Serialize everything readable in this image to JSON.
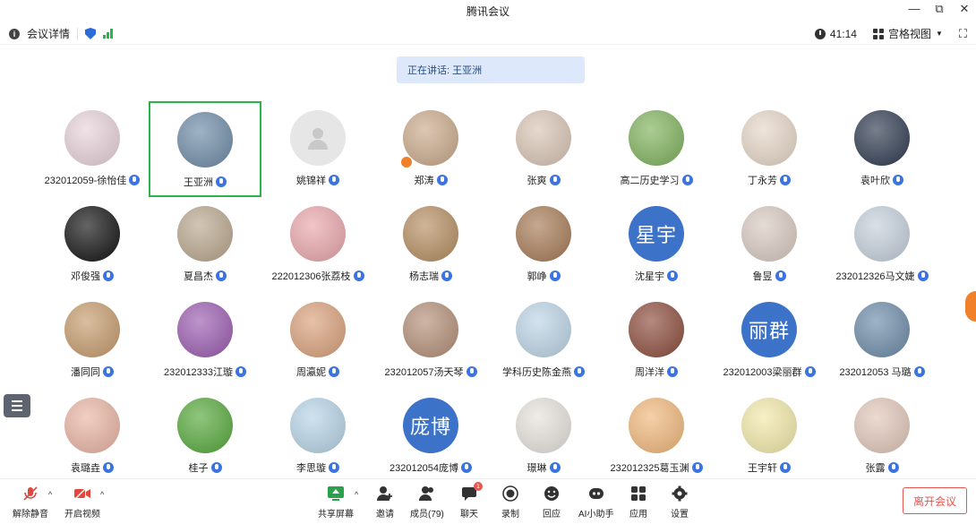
{
  "window": {
    "title": "腾讯会议",
    "minimize": "—",
    "restore": "⧉",
    "close": "✕"
  },
  "topbar": {
    "meeting_info": "会议详情",
    "timer": "41:14",
    "view_mode": "宫格视图",
    "colors": {
      "shield": "#2a6bd8",
      "signal": "#2cb34a"
    }
  },
  "speaking_banner": "正在讲话: 王亚洲",
  "participants": [
    {
      "name": "232012059-徐怡佳",
      "avatar_bg": "#e7d2d9"
    },
    {
      "name": "王亚洲",
      "avatar_bg": "#6d8aa6",
      "active": true
    },
    {
      "name": "姚锦祥",
      "avatar_bg": "#e6e6e6",
      "default": true
    },
    {
      "name": "郑涛",
      "avatar_bg": "#caa98a",
      "host": true
    },
    {
      "name": "张爽",
      "avatar_bg": "#d9c4b4"
    },
    {
      "name": "高二历史学习",
      "avatar_bg": "#7fb25c"
    },
    {
      "name": "丁永芳",
      "avatar_bg": "#e6d6c6"
    },
    {
      "name": "袁叶欣",
      "avatar_bg": "#2e3a4f"
    },
    {
      "name": "邓俊强",
      "avatar_bg": "#111111"
    },
    {
      "name": "夏昌杰",
      "avatar_bg": "#b9a68d"
    },
    {
      "name": "222012306张荔枝",
      "avatar_bg": "#e9a6ab"
    },
    {
      "name": "杨志瑞",
      "avatar_bg": "#b58d60"
    },
    {
      "name": "郭峥",
      "avatar_bg": "#a67a55"
    },
    {
      "name": "沈星宇",
      "avatar_bg": "#3c73c8",
      "text": "星宇"
    },
    {
      "name": "鲁昱",
      "avatar_bg": "#d8c9c0"
    },
    {
      "name": "232012326马文婕",
      "avatar_bg": "#c4cfdb"
    },
    {
      "name": "潘同同",
      "avatar_bg": "#c59b6c"
    },
    {
      "name": "232012333江璇",
      "avatar_bg": "#9a5bb0"
    },
    {
      "name": "周瀛妮",
      "avatar_bg": "#d9a07a"
    },
    {
      "name": "232012057汤天琴",
      "avatar_bg": "#b38e76"
    },
    {
      "name": "学科历史陈金燕",
      "avatar_bg": "#bcd4e6"
    },
    {
      "name": "周洋洋",
      "avatar_bg": "#8c4b3b"
    },
    {
      "name": "232012003梁丽群",
      "avatar_bg": "#3c73c8",
      "text": "丽群"
    },
    {
      "name": "232012053 马璐",
      "avatar_bg": "#6b8ba8"
    },
    {
      "name": "袁璐垚",
      "avatar_bg": "#e9b4a3"
    },
    {
      "name": "桂子",
      "avatar_bg": "#55a83a"
    },
    {
      "name": "李思璇",
      "avatar_bg": "#b6d3e6"
    },
    {
      "name": "232012054庞博",
      "avatar_bg": "#3c73c8",
      "text": "庞博"
    },
    {
      "name": "璟琳",
      "avatar_bg": "#e6e2dc"
    },
    {
      "name": "232012325葛玉渊",
      "avatar_bg": "#f1b77a"
    },
    {
      "name": "王宇轩",
      "avatar_bg": "#f2e8a8"
    },
    {
      "name": "张露",
      "avatar_bg": "#e1c6b8"
    }
  ],
  "toolbar": {
    "unmute": "解除静音",
    "start_video": "开启视频",
    "share_screen": "共享屏幕",
    "invite": "邀请",
    "members": "成员(79)",
    "chat": "聊天",
    "chat_badge": "1",
    "record": "录制",
    "reactions": "回应",
    "ai_assistant": "AI小助手",
    "apps": "应用",
    "settings": "设置",
    "leave": "离开会议",
    "caret": "^"
  }
}
